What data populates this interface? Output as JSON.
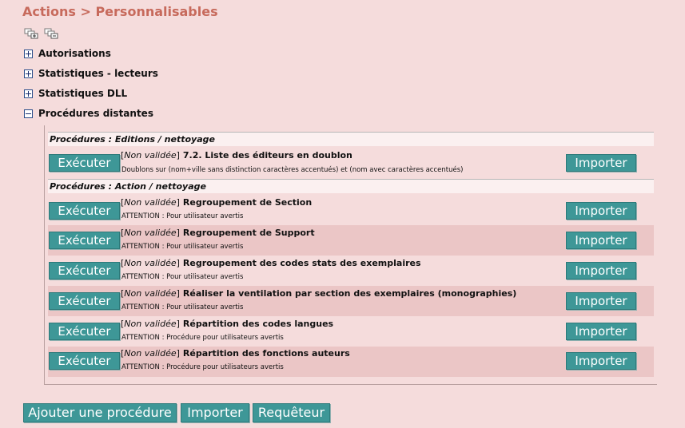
{
  "page": {
    "title": "Actions > Personnalisables"
  },
  "icons": {
    "expand_all": "expand-all-icon",
    "collapse_all": "collapse-all-icon",
    "plus": "plus-box-icon",
    "minus": "minus-box-icon"
  },
  "tree": [
    {
      "label": "Autorisations",
      "expanded": false
    },
    {
      "label": "Statistiques - lecteurs",
      "expanded": false
    },
    {
      "label": "Statistiques DLL",
      "expanded": false
    },
    {
      "label": "Procédures distantes",
      "expanded": true
    }
  ],
  "sections": [
    {
      "title": "Procédures : Editions / nettoyage",
      "procedures": [
        {
          "status": "Non validée",
          "name": "7.2. Liste des éditeurs en doublon",
          "desc": "Doublons sur (nom+ville sans distinction caractères accentués) et (nom avec caractères accentués)"
        }
      ]
    },
    {
      "title": "Procédures : Action / nettoyage",
      "procedures": [
        {
          "status": "Non validée",
          "name": "Regroupement de Section",
          "desc": "ATTENTION : Pour utilisateur avertis"
        },
        {
          "status": "Non validée",
          "name": "Regroupement de Support",
          "desc": "ATTENTION : Pour utilisateur avertis"
        },
        {
          "status": "Non validée",
          "name": "Regroupement des codes stats des exemplaires",
          "desc": "ATTENTION : Pour utilisateur avertis"
        },
        {
          "status": "Non validée",
          "name": "Réaliser la ventilation par section des exemplaires (monographies)",
          "desc": "ATTENTION : Pour utilisateur avertis"
        },
        {
          "status": "Non validée",
          "name": "Répartition des codes langues",
          "desc": "ATTENTION : Procédure pour utilisateurs avertis"
        },
        {
          "status": "Non validée",
          "name": "Répartition des fonctions auteurs",
          "desc": "ATTENTION : Procédure pour utilisateurs avertis"
        }
      ]
    }
  ],
  "labels": {
    "execute": "Exécuter",
    "import": "Importer"
  },
  "bottom_buttons": {
    "add": "Ajouter une procédure",
    "import": "Importer",
    "query": "Requêteur"
  },
  "colors": {
    "title": "#c76a5c",
    "button": "#3e9797",
    "background": "#f5dcdc",
    "row_alt": "#ebc6c6"
  }
}
